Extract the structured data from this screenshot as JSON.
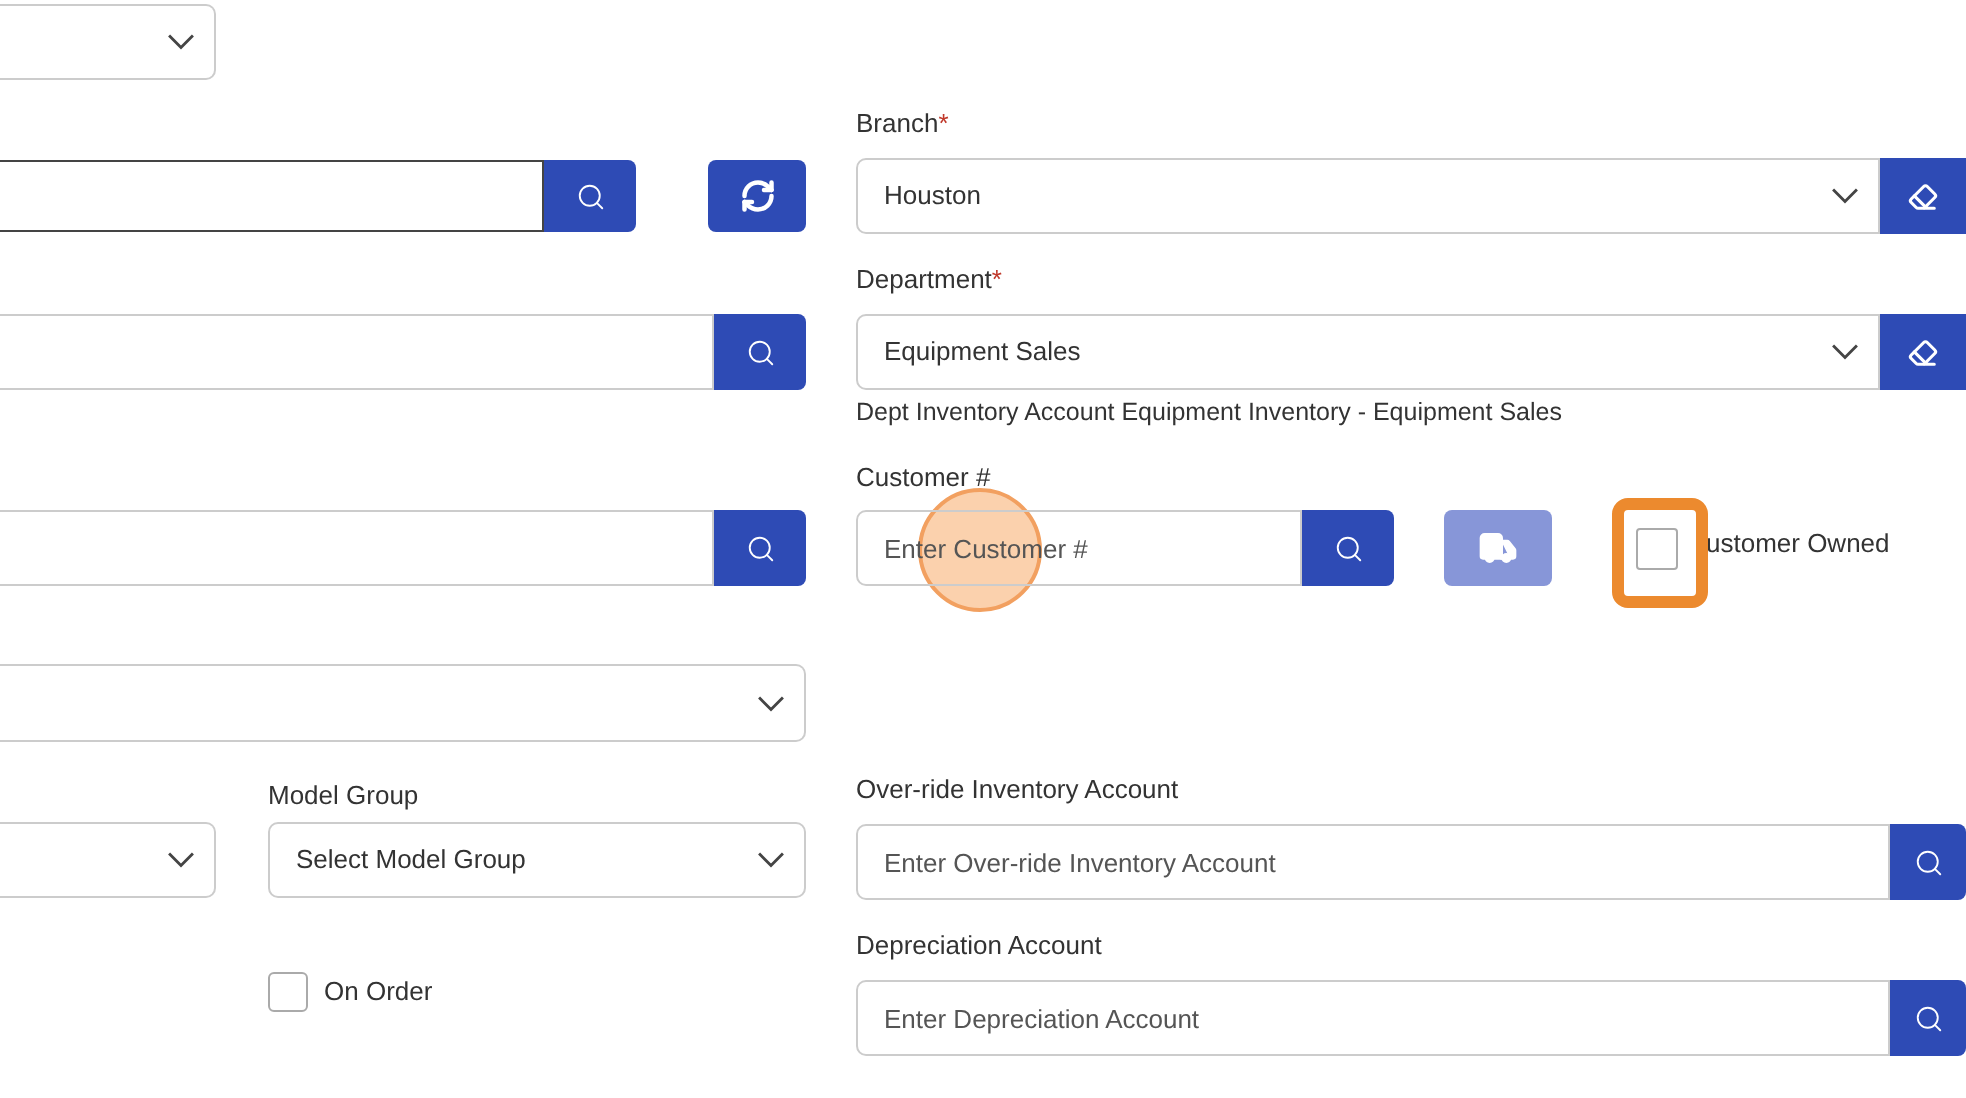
{
  "left": {
    "model_group": {
      "label": "Model Group",
      "placeholder": "Select Model Group"
    },
    "on_order": {
      "label": "On Order",
      "checked": false
    }
  },
  "right": {
    "branch": {
      "label": "Branch",
      "required_mark": "*",
      "value": "Houston"
    },
    "department": {
      "label": "Department",
      "required_mark": "*",
      "value": "Equipment Sales",
      "help": "Dept Inventory Account Equipment Inventory - Equipment Sales"
    },
    "customer": {
      "label": "Customer #",
      "placeholder": "Enter Customer #",
      "clicked": true
    },
    "truck_button": {
      "disabled": true
    },
    "customer_owned": {
      "label": "ustomer Owned",
      "checked": false,
      "highlighted": true
    },
    "override_account": {
      "label": "Over-ride Inventory Account",
      "placeholder": "Enter Over-ride Inventory Account"
    },
    "depreciation_account": {
      "label": "Depreciation Account",
      "placeholder": "Enter Depreciation Account"
    }
  }
}
